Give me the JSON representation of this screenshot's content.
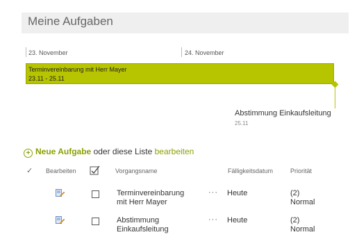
{
  "title": "Meine Aufgaben",
  "timeline": {
    "dates": [
      "23. November",
      "24. November"
    ],
    "bar": {
      "name": "Terminvereinbarung mit Herr Mayer",
      "range": "23.11 - 25.11"
    },
    "callout": {
      "name": "Abstimmung Einkaufsleitung",
      "date": "25.11"
    }
  },
  "newtask": {
    "label": "Neue Aufgabe",
    "middle": " oder diese Liste ",
    "edit": "bearbeiten"
  },
  "columns": {
    "check": "✓",
    "edit": "Bearbeiten",
    "name": "Vorgangsname",
    "due": "Fälligkeitsdatum",
    "priority": "Priorität"
  },
  "rows": [
    {
      "name_l1": "Terminvereinbarung",
      "name_l2": "mit Herr Mayer",
      "due": "Heute",
      "prio_l1": "(2)",
      "prio_l2": "Normal"
    },
    {
      "name_l1": "Abstimmung",
      "name_l2": "Einkaufsleitung",
      "due": "Heute",
      "prio_l1": "(2)",
      "prio_l2": "Normal"
    }
  ],
  "colors": {
    "accent": "#b7c400",
    "link": "#8aa000"
  }
}
